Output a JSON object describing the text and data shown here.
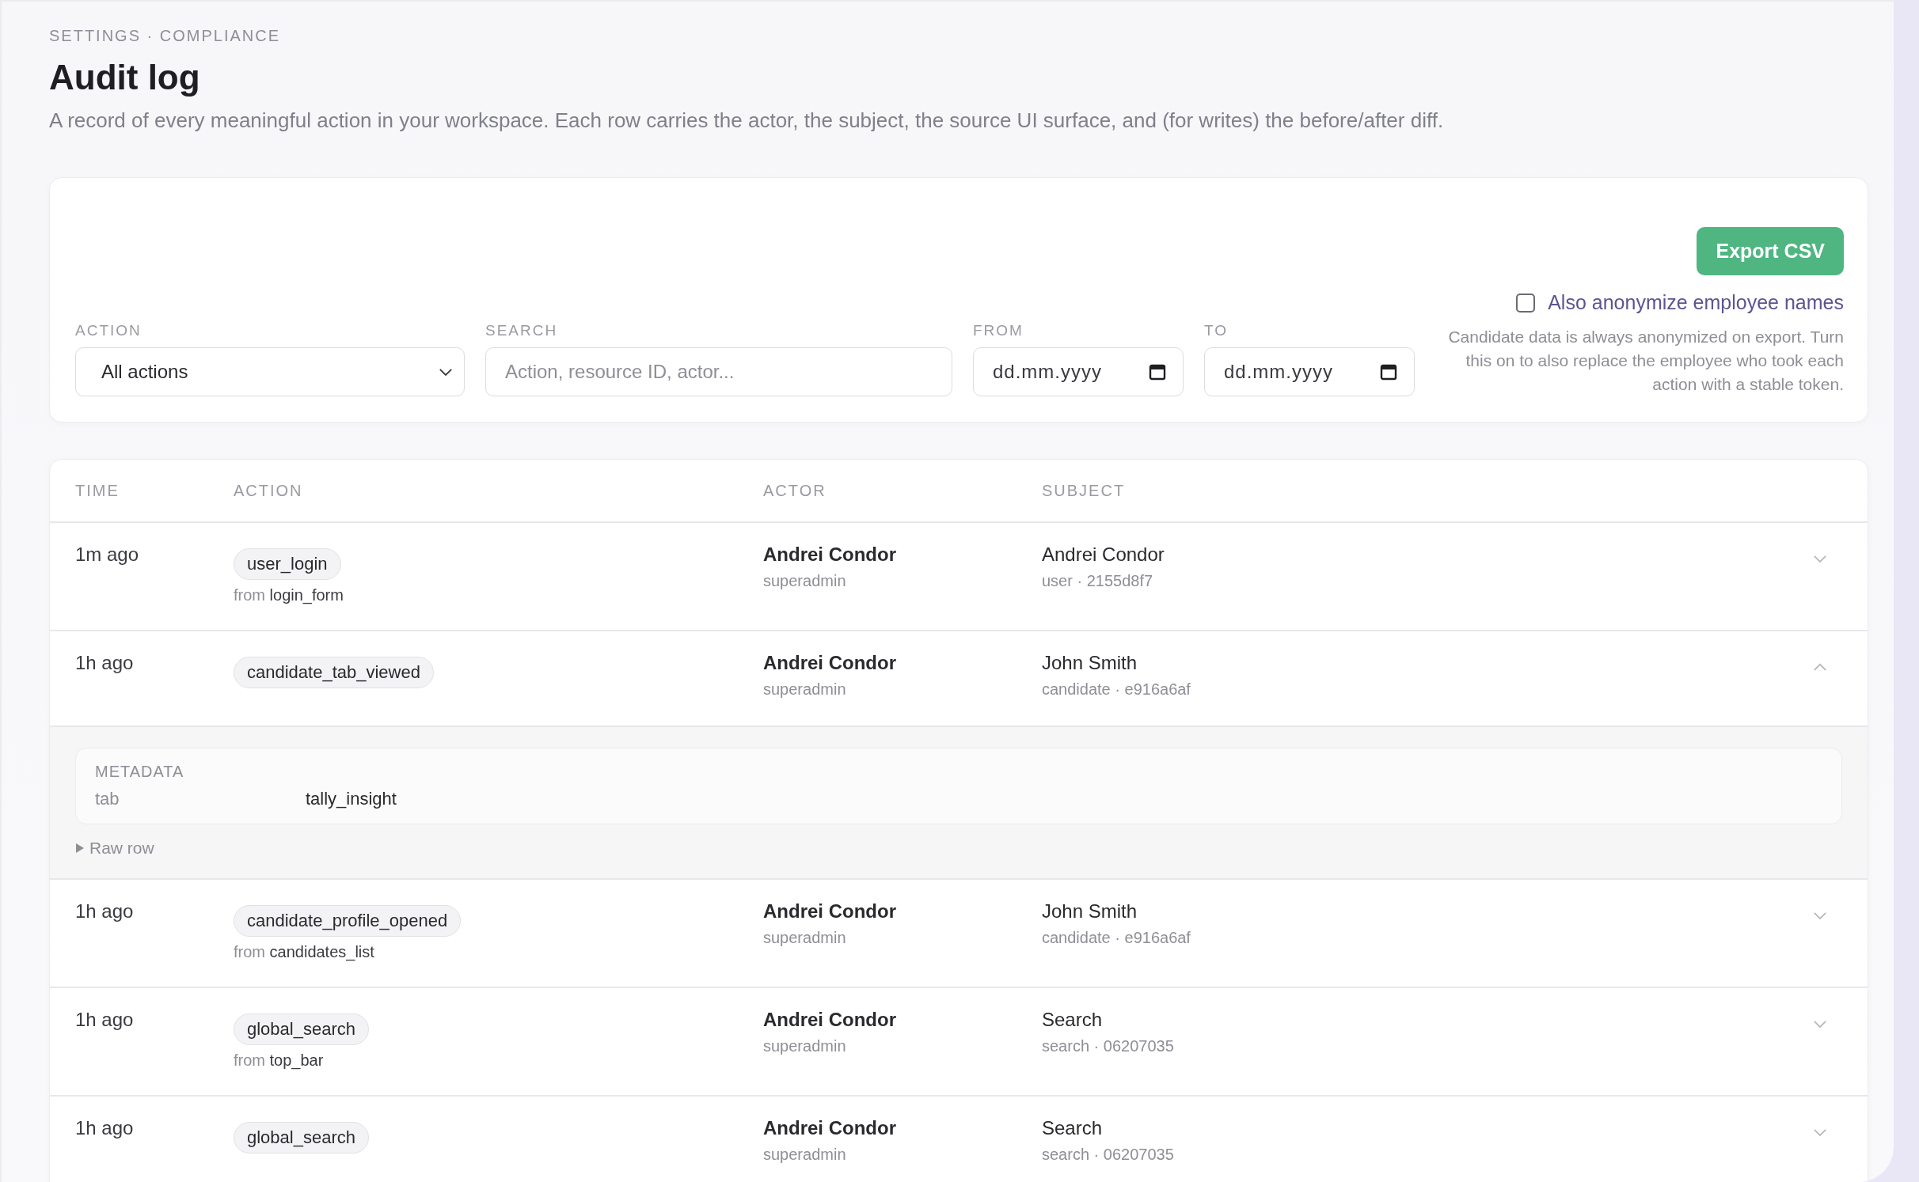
{
  "breadcrumb": "SETTINGS · COMPLIANCE",
  "title": "Audit log",
  "description": "A record of every meaningful action in your workspace. Each row carries the actor, the subject, the source UI surface, and (for writes) the before/after diff.",
  "filters": {
    "action": {
      "label": "ACTION",
      "value": "All actions"
    },
    "search": {
      "label": "SEARCH",
      "placeholder": "Action, resource ID, actor..."
    },
    "from": {
      "label": "FROM",
      "placeholder": "dd.mm.yyyy"
    },
    "to": {
      "label": "TO",
      "placeholder": "dd.mm.yyyy"
    }
  },
  "export": {
    "button": "Export CSV",
    "checkbox_label": "Also anonymize employee names",
    "checked": false,
    "note": "Candidate data is always anonymized on export. Turn this on to also replace the employee who took each action with a stable token."
  },
  "table": {
    "columns": [
      "TIME",
      "ACTION",
      "ACTOR",
      "SUBJECT"
    ],
    "rows": [
      {
        "time": "1m ago",
        "action": "user_login",
        "source_prefix": "from",
        "source": "login_form",
        "actor": "Andrei Condor",
        "role": "superadmin",
        "subject": "Andrei Condor",
        "subject_meta": "user · 2155d8f7",
        "expanded": false
      },
      {
        "time": "1h ago",
        "action": "candidate_tab_viewed",
        "actor": "Andrei Condor",
        "role": "superadmin",
        "subject": "John Smith",
        "subject_meta": "candidate · e916a6af",
        "expanded": true,
        "details": {
          "title": "METADATA",
          "items": [
            {
              "key": "tab",
              "value": "tally_insight"
            }
          ],
          "raw_label": "Raw row"
        }
      },
      {
        "time": "1h ago",
        "action": "candidate_profile_opened",
        "source_prefix": "from",
        "source": "candidates_list",
        "actor": "Andrei Condor",
        "role": "superadmin",
        "subject": "John Smith",
        "subject_meta": "candidate · e916a6af",
        "expanded": false
      },
      {
        "time": "1h ago",
        "action": "global_search",
        "source_prefix": "from",
        "source": "top_bar",
        "actor": "Andrei Condor",
        "role": "superadmin",
        "subject": "Search",
        "subject_meta": "search · 06207035",
        "expanded": false
      },
      {
        "time": "1h ago",
        "action": "global_search",
        "actor": "Andrei Condor",
        "role": "superadmin",
        "subject": "Search",
        "subject_meta": "search · 06207035",
        "expanded": false
      }
    ]
  }
}
